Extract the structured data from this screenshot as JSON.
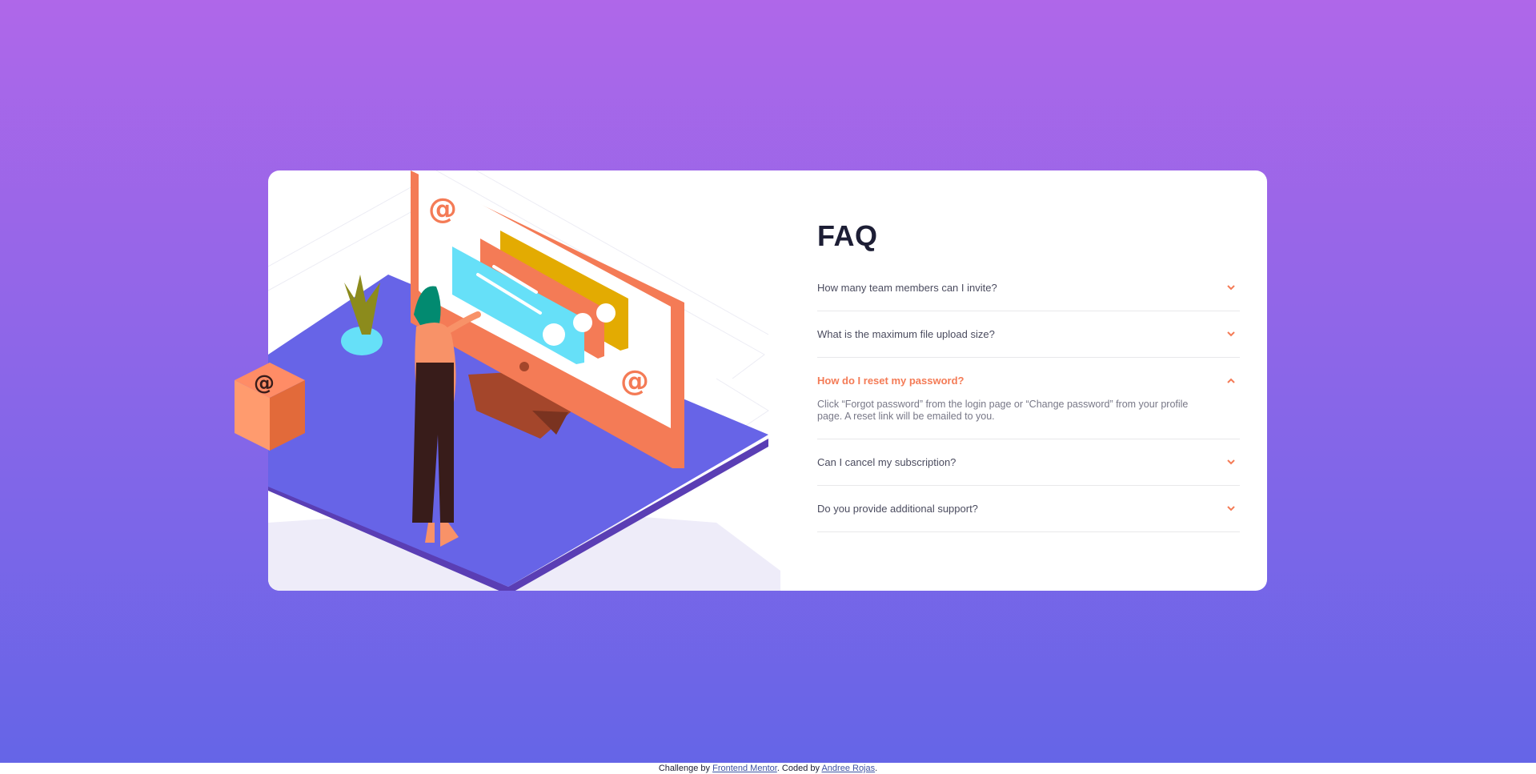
{
  "faq": {
    "title": "FAQ",
    "items": [
      {
        "question": "How many team members can I invite?",
        "open": false
      },
      {
        "question": "What is the maximum file upload size?",
        "open": false
      },
      {
        "question": "How do I reset my password?",
        "open": true,
        "answer": "Click “Forgot password” from the login page or “Change password” from your profile page. A reset link will be emailed to you."
      },
      {
        "question": "Can I cancel my subscription?",
        "open": false
      },
      {
        "question": "Do you provide additional support?",
        "open": false
      }
    ]
  },
  "footer": {
    "prefix": "Challenge by ",
    "link1": "Frontend Mentor",
    "middle": ". Coded by ",
    "link2": "Andree Rojas",
    "suffix": "."
  },
  "colors": {
    "accent": "#f47b56",
    "heading": "#1d1e35",
    "text": "#4b4c5f",
    "divider": "#e8e8ea",
    "bg_top": "#af67e9",
    "bg_bottom": "#6565e7"
  },
  "icons": {
    "chevron_down": "chevron-down-icon",
    "chevron_up": "chevron-up-icon"
  }
}
